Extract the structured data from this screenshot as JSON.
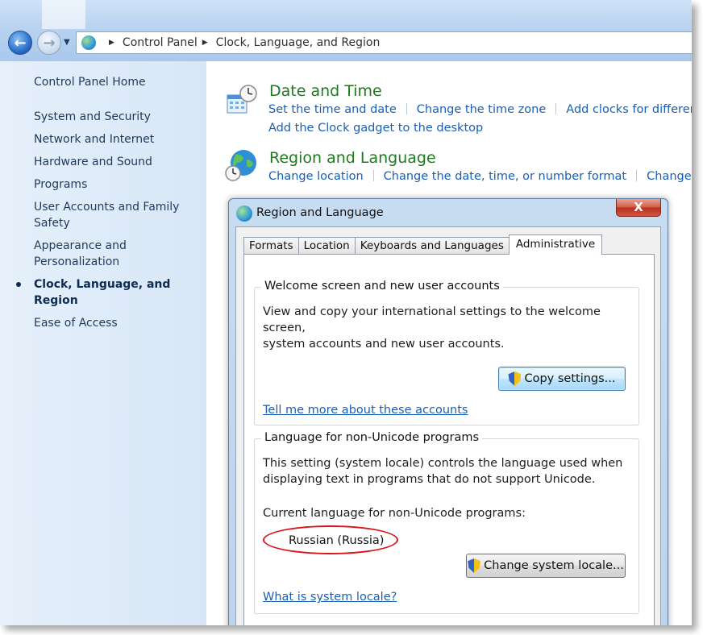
{
  "address_bar": {
    "crumbs": [
      "Control Panel",
      "Clock, Language, and Region"
    ]
  },
  "left_nav": {
    "home": "Control Panel Home",
    "items": [
      {
        "label": "System and Security"
      },
      {
        "label": "Network and Internet"
      },
      {
        "label": "Hardware and Sound"
      },
      {
        "label": "Programs"
      },
      {
        "label": "User Accounts and Family Safety"
      },
      {
        "label": "Appearance and Personalization"
      },
      {
        "label": "Clock, Language, and Region",
        "current": true
      },
      {
        "label": "Ease of Access"
      }
    ]
  },
  "categories": [
    {
      "title": "Date and Time",
      "icon": "calendar-clock-icon",
      "links": [
        "Set the time and date",
        "Change the time zone",
        "Add clocks for different time zones"
      ],
      "links_row2": [
        "Add the Clock gadget to the desktop"
      ]
    },
    {
      "title": "Region and Language",
      "icon": "globe-clock-icon",
      "links": [
        "Change location",
        "Change the date, time, or number format",
        "Change keyboards"
      ]
    }
  ],
  "dialog": {
    "title": "Region and Language",
    "close_label": "X",
    "tabs": [
      {
        "label": "Formats"
      },
      {
        "label": "Location"
      },
      {
        "label": "Keyboards and Languages"
      },
      {
        "label": "Administrative",
        "active": true
      }
    ],
    "welcome_group": {
      "title": "Welcome screen and new user accounts",
      "text_line1": "View and copy your international settings to the welcome screen,",
      "text_line2": "system accounts and new user accounts.",
      "button": "Copy settings...",
      "link": "Tell me more about these accounts"
    },
    "unicode_group": {
      "title": "Language for non-Unicode programs",
      "text_line1": "This setting (system locale) controls the language used when",
      "text_line2": "displaying text in programs that do not support Unicode.",
      "current_label": "Current language for non-Unicode programs:",
      "current_value": "Russian (Russia)",
      "button": "Change system locale...",
      "link": "What is system locale?"
    }
  },
  "colors": {
    "category_title": "#1e7a1e",
    "link": "#1a5fb4",
    "nav_text": "#1e395b",
    "highlight_oval": "#d9141b"
  }
}
